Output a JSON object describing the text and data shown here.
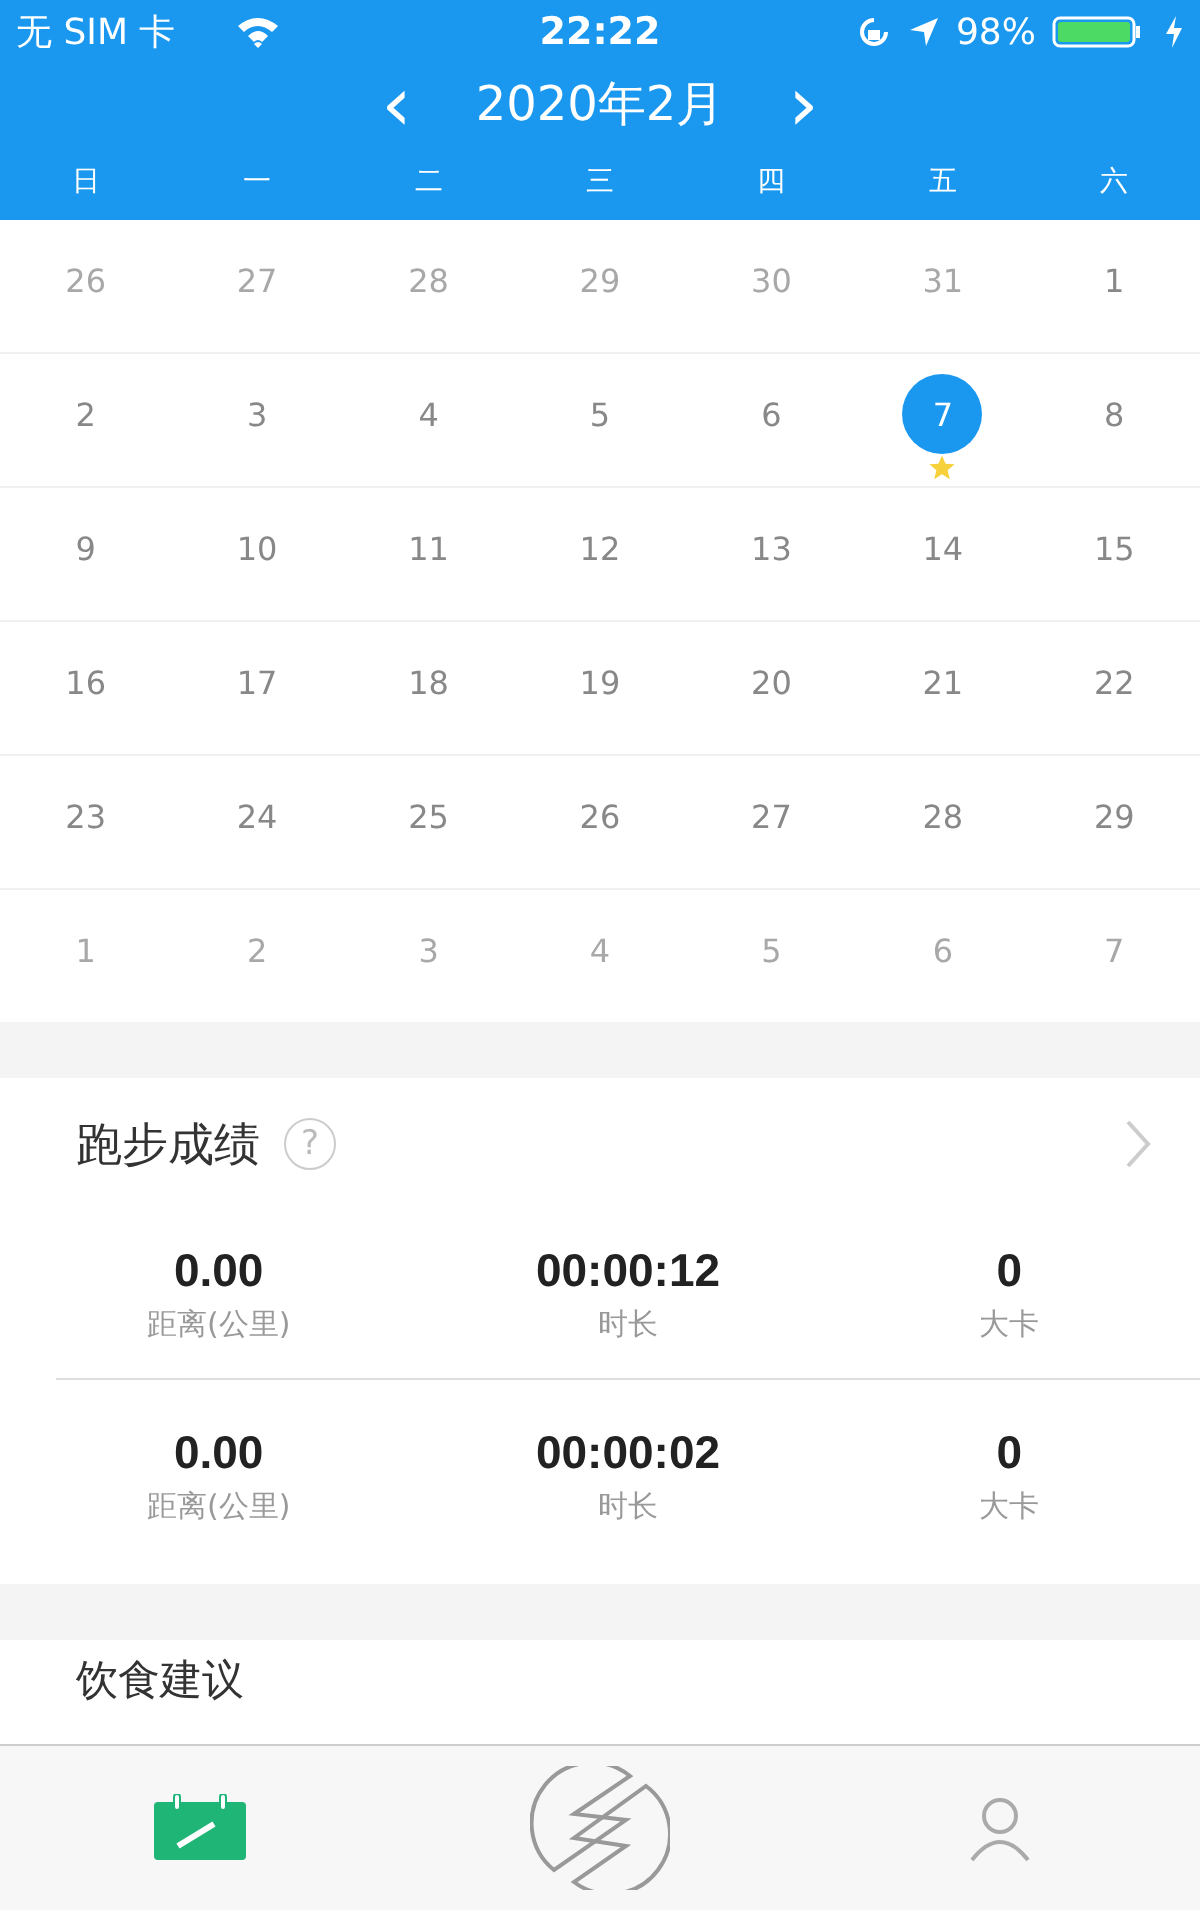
{
  "status_bar": {
    "carrier": "无 SIM 卡",
    "time": "22:22",
    "battery": "98%"
  },
  "header": {
    "prev": "‹",
    "title": "2020年2月",
    "next": "›"
  },
  "weekdays": [
    "日",
    "一",
    "二",
    "三",
    "四",
    "五",
    "六"
  ],
  "weeks": [
    [
      {
        "text": "26",
        "in_month": false,
        "selected": false,
        "starred": false
      },
      {
        "text": "27",
        "in_month": false,
        "selected": false,
        "starred": false
      },
      {
        "text": "28",
        "in_month": false,
        "selected": false,
        "starred": false
      },
      {
        "text": "29",
        "in_month": false,
        "selected": false,
        "starred": false
      },
      {
        "text": "30",
        "in_month": false,
        "selected": false,
        "starred": false
      },
      {
        "text": "31",
        "in_month": false,
        "selected": false,
        "starred": false
      },
      {
        "text": "1",
        "in_month": true,
        "selected": false,
        "starred": false
      }
    ],
    [
      {
        "text": "2",
        "in_month": true,
        "selected": false,
        "starred": false
      },
      {
        "text": "3",
        "in_month": true,
        "selected": false,
        "starred": false
      },
      {
        "text": "4",
        "in_month": true,
        "selected": false,
        "starred": false
      },
      {
        "text": "5",
        "in_month": true,
        "selected": false,
        "starred": false
      },
      {
        "text": "6",
        "in_month": true,
        "selected": false,
        "starred": false
      },
      {
        "text": "7",
        "in_month": true,
        "selected": true,
        "starred": true
      },
      {
        "text": "8",
        "in_month": true,
        "selected": false,
        "starred": false
      }
    ],
    [
      {
        "text": "9",
        "in_month": true,
        "selected": false,
        "starred": false
      },
      {
        "text": "10",
        "in_month": true,
        "selected": false,
        "starred": false
      },
      {
        "text": "11",
        "in_month": true,
        "selected": false,
        "starred": false
      },
      {
        "text": "12",
        "in_month": true,
        "selected": false,
        "starred": false
      },
      {
        "text": "13",
        "in_month": true,
        "selected": false,
        "starred": false
      },
      {
        "text": "14",
        "in_month": true,
        "selected": false,
        "starred": false
      },
      {
        "text": "15",
        "in_month": true,
        "selected": false,
        "starred": false
      }
    ],
    [
      {
        "text": "16",
        "in_month": true,
        "selected": false,
        "starred": false
      },
      {
        "text": "17",
        "in_month": true,
        "selected": false,
        "starred": false
      },
      {
        "text": "18",
        "in_month": true,
        "selected": false,
        "starred": false
      },
      {
        "text": "19",
        "in_month": true,
        "selected": false,
        "starred": false
      },
      {
        "text": "20",
        "in_month": true,
        "selected": false,
        "starred": false
      },
      {
        "text": "21",
        "in_month": true,
        "selected": false,
        "starred": false
      },
      {
        "text": "22",
        "in_month": true,
        "selected": false,
        "starred": false
      }
    ],
    [
      {
        "text": "23",
        "in_month": true,
        "selected": false,
        "starred": false
      },
      {
        "text": "24",
        "in_month": true,
        "selected": false,
        "starred": false
      },
      {
        "text": "25",
        "in_month": true,
        "selected": false,
        "starred": false
      },
      {
        "text": "26",
        "in_month": true,
        "selected": false,
        "starred": false
      },
      {
        "text": "27",
        "in_month": true,
        "selected": false,
        "starred": false
      },
      {
        "text": "28",
        "in_month": true,
        "selected": false,
        "starred": false
      },
      {
        "text": "29",
        "in_month": true,
        "selected": false,
        "starred": false
      }
    ],
    [
      {
        "text": "1",
        "in_month": false,
        "selected": false,
        "starred": false
      },
      {
        "text": "2",
        "in_month": false,
        "selected": false,
        "starred": false
      },
      {
        "text": "3",
        "in_month": false,
        "selected": false,
        "starred": false
      },
      {
        "text": "4",
        "in_month": false,
        "selected": false,
        "starred": false
      },
      {
        "text": "5",
        "in_month": false,
        "selected": false,
        "starred": false
      },
      {
        "text": "6",
        "in_month": false,
        "selected": false,
        "starred": false
      },
      {
        "text": "7",
        "in_month": false,
        "selected": false,
        "starred": false
      }
    ]
  ],
  "run_results": {
    "title": "跑步成绩",
    "help": "?",
    "records": [
      [
        {
          "value": "0.00",
          "label": "距离(公里)"
        },
        {
          "value": "00:00:12",
          "label": "时长"
        },
        {
          "value": "0",
          "label": "大卡"
        }
      ],
      [
        {
          "value": "0.00",
          "label": "距离(公里)"
        },
        {
          "value": "00:00:02",
          "label": "时长"
        },
        {
          "value": "0",
          "label": "大卡"
        }
      ]
    ]
  },
  "diet": {
    "title": "饮食建议"
  },
  "tab_bar": [
    {
      "kind": "calendar",
      "selected": true
    },
    {
      "kind": "logo",
      "selected": false
    },
    {
      "kind": "profile",
      "selected": false
    }
  ]
}
